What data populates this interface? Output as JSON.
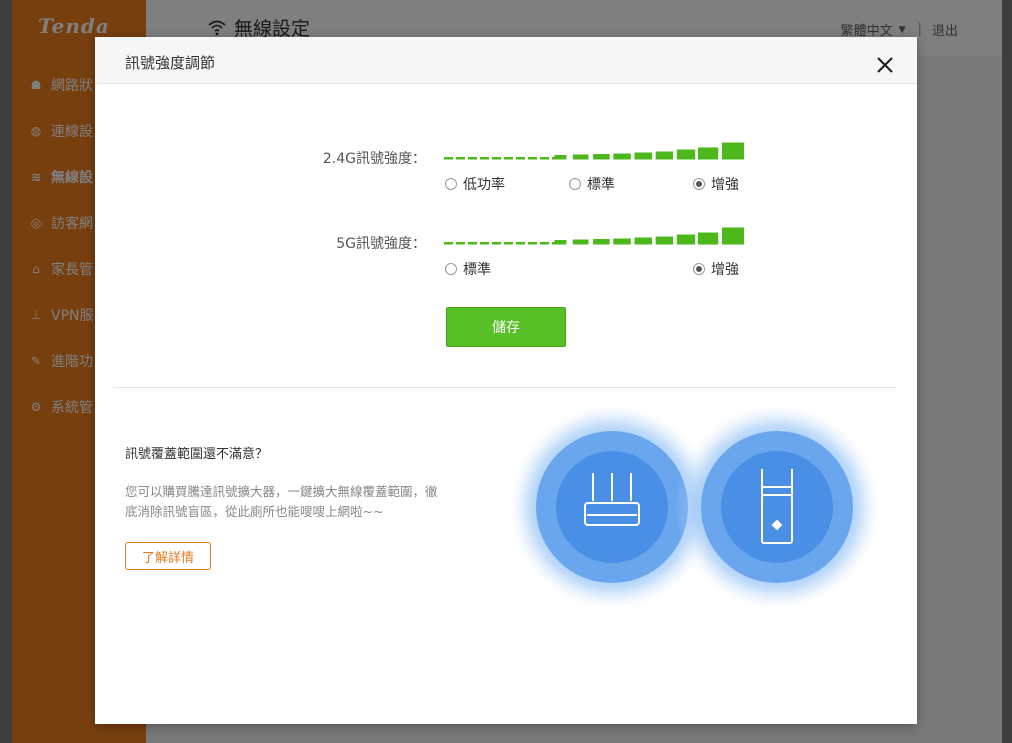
{
  "app": {
    "logo": "Tenda",
    "page_title": "無線設定",
    "language": "繁體中文",
    "logout": "退出"
  },
  "sidebar": {
    "items": [
      {
        "label": "網路狀",
        "icon": "network-icon",
        "glyph": "☗"
      },
      {
        "label": "連線設",
        "icon": "globe-icon",
        "glyph": "◍"
      },
      {
        "label": "無線設",
        "icon": "wifi-icon",
        "glyph": "≋",
        "active": true
      },
      {
        "label": "訪客網",
        "icon": "guest-icon",
        "glyph": "◎"
      },
      {
        "label": "家長管",
        "icon": "parental-icon",
        "glyph": "⌂"
      },
      {
        "label": "VPN服",
        "icon": "vpn-icon",
        "glyph": "⊥"
      },
      {
        "label": "進階功",
        "icon": "wrench-icon",
        "glyph": "✎"
      },
      {
        "label": "系統管",
        "icon": "gear-icon",
        "glyph": "⚙"
      }
    ]
  },
  "modal": {
    "title": "訊號強度調節",
    "band24": {
      "label": "2.4G訊號強度：",
      "options": [
        "低功率",
        "標準",
        "增強"
      ],
      "selected": "增強"
    },
    "band5": {
      "label": "5G訊號強度：",
      "options": [
        "標準",
        "增強"
      ],
      "selected": "增強"
    },
    "save_label": "儲存",
    "promo": {
      "title": "訊號覆蓋範圍還不滿意？",
      "description": "您可以購買騰達訊號擴大器，一鍵擴大無線覆蓋範圍，徹底消除訊號盲區，從此廁所也能嗖嗖上網啦~~",
      "more_label": "了解詳情"
    }
  },
  "colors": {
    "sidebar": "#ef7e1c",
    "accent_green": "#58c027",
    "bar_green": "#4cb81c",
    "promo_orange": "#e27b1f",
    "glow_blue": "#4a90e2"
  }
}
